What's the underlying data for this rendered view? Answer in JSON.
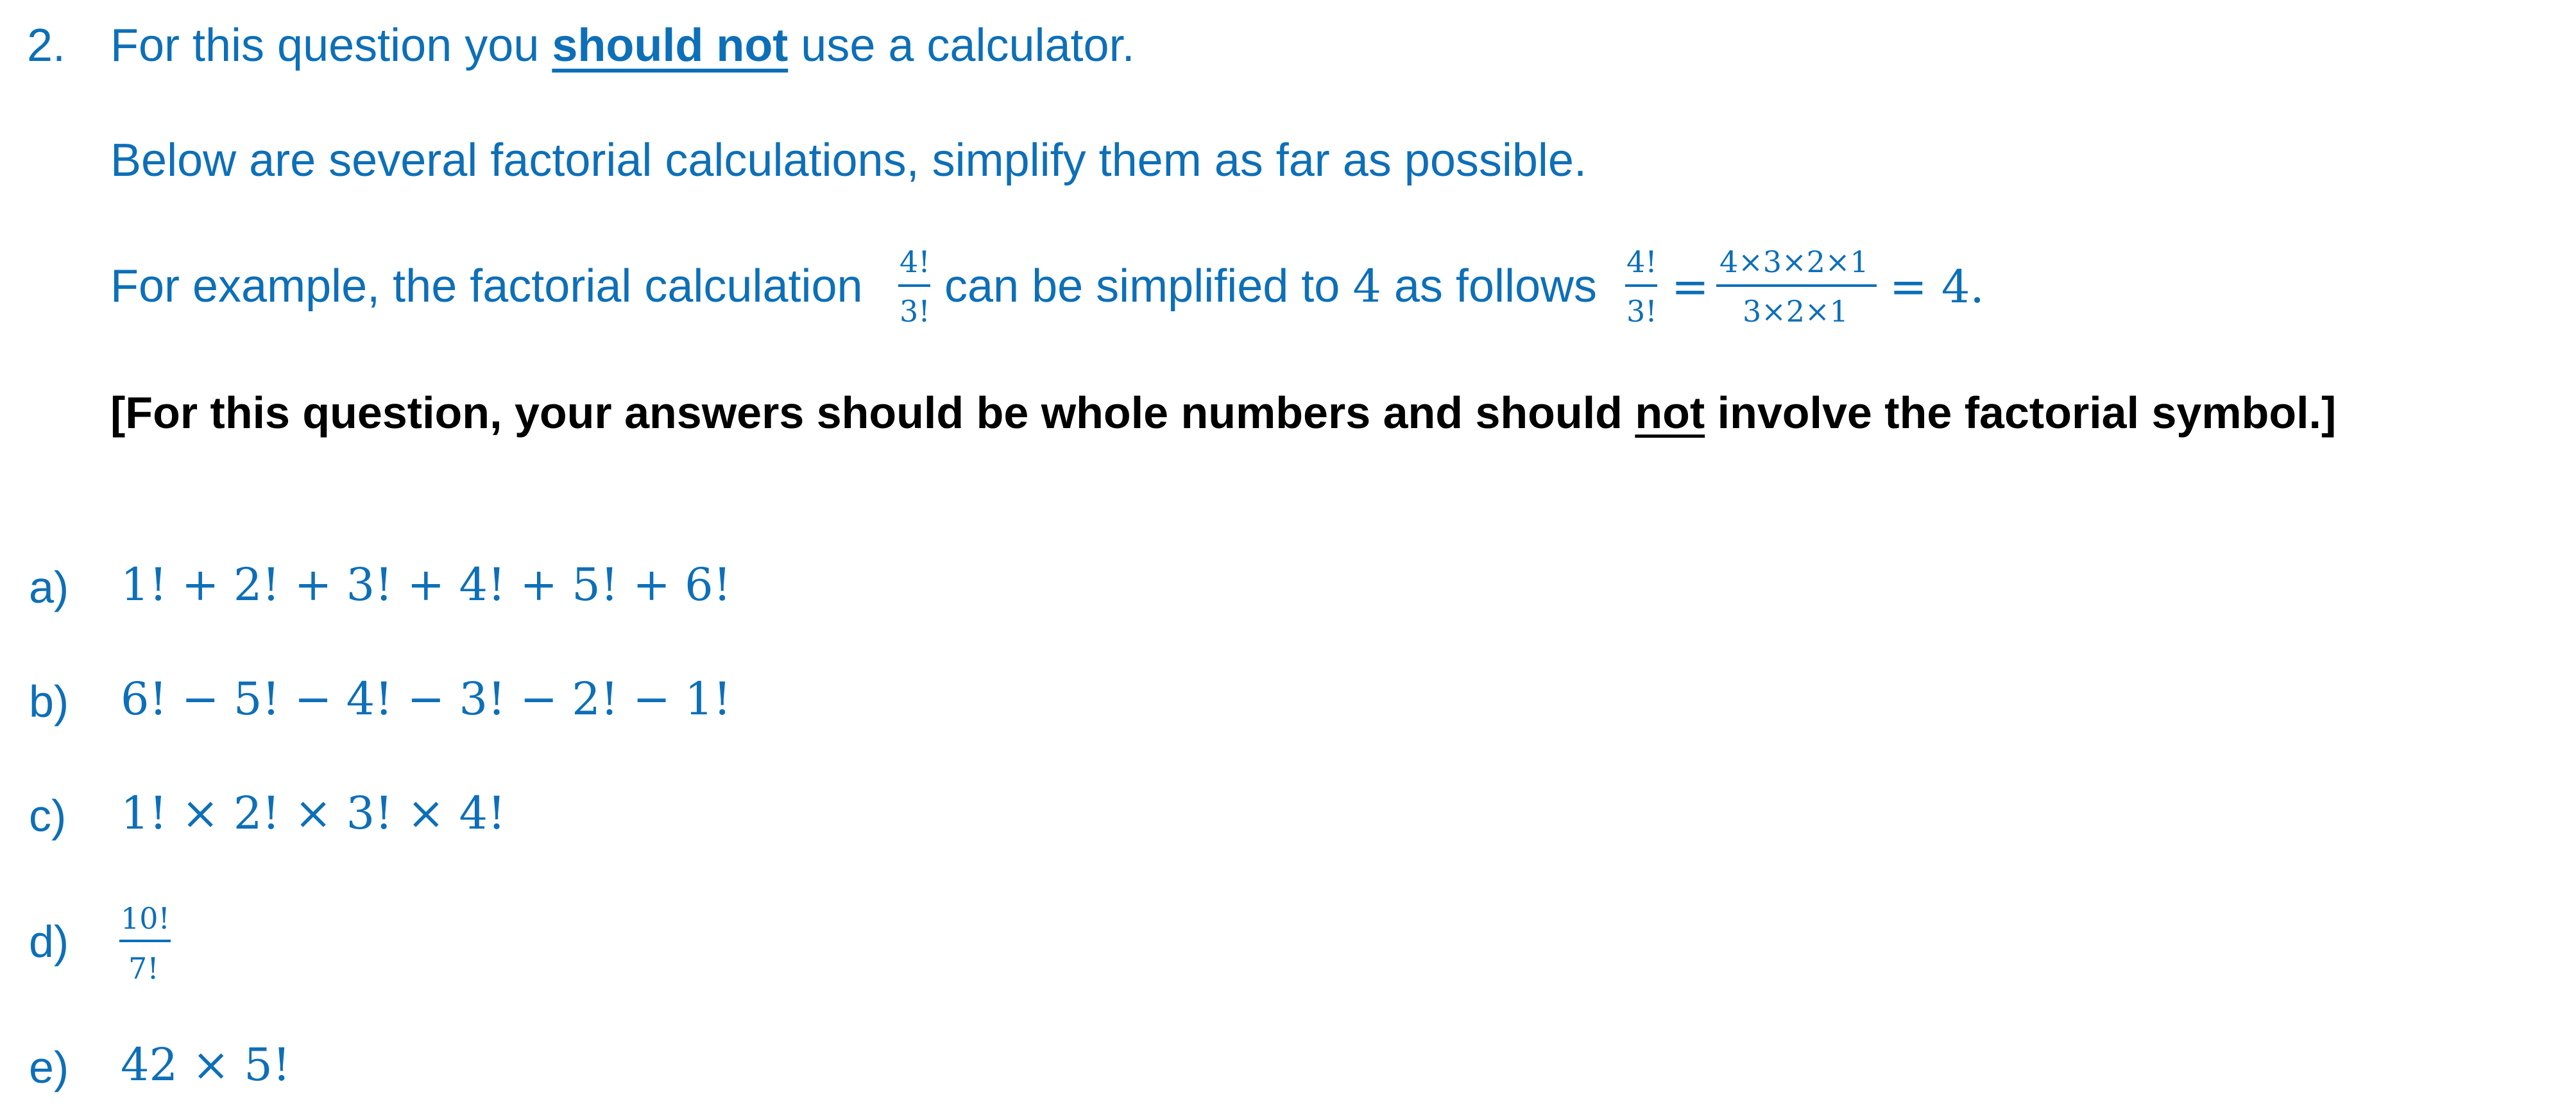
{
  "question": {
    "number": "2.",
    "instruction_pre": "For this question you ",
    "instruction_emph": "should not",
    "instruction_post": " use a calculator.",
    "line2": "Below are several factorial calculations, simplify them as far as possible.",
    "example_pre": "For example, the factorial calculation",
    "example_frac_num": "4!",
    "example_frac_den": "3!",
    "example_mid_pre": "can be simplified to ",
    "example_value": "4",
    "example_mid_post": " as follows",
    "example_frac2_num": "4!",
    "example_frac2_den": "3!",
    "equals1": "=",
    "example_frac3_num": "4×3×2×1",
    "example_frac3_den": "3×2×1",
    "equals2": "= 4.",
    "note_pre": "[For this question, your answers should be whole numbers and should ",
    "note_emph": "not",
    "note_post": " involve the factorial symbol.]"
  },
  "parts": [
    {
      "label": "a)",
      "expr": "1! + 2! + 3! + 4! + 5! + 6!"
    },
    {
      "label": "b)",
      "expr": "6! − 5! − 4! − 3! − 2! − 1!"
    },
    {
      "label": "c)",
      "expr": "1! × 2! × 3! × 4!"
    },
    {
      "label": "d)",
      "frac_num": "10!",
      "frac_den": "7!"
    },
    {
      "label": "e)",
      "expr": "42 × 5!"
    }
  ]
}
